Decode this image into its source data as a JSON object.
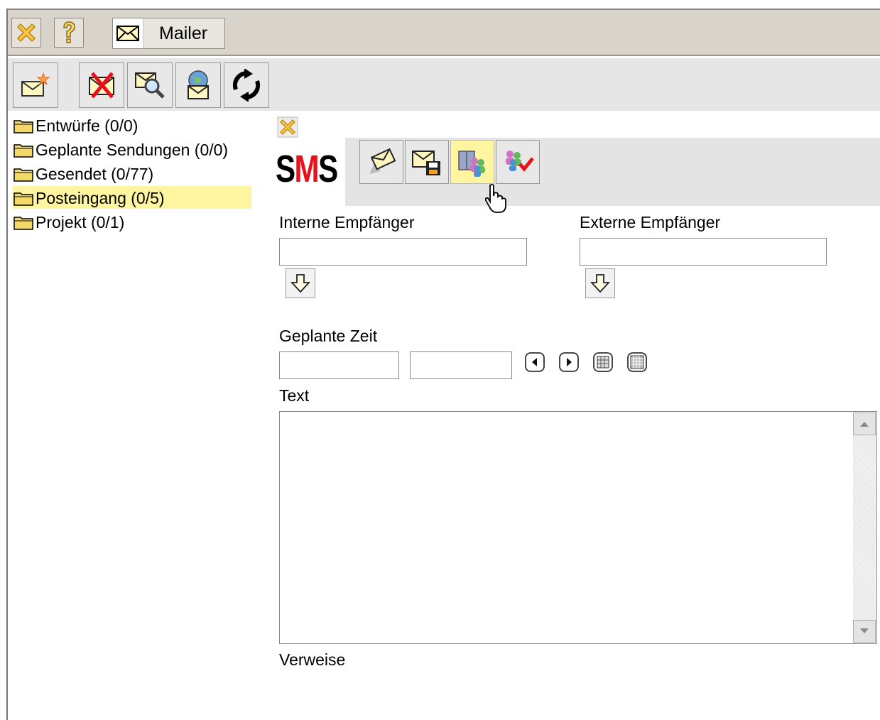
{
  "app": {
    "tab_label": "Mailer"
  },
  "folders": [
    {
      "label": "Entwürfe (0/0)"
    },
    {
      "label": "Geplante Sendungen (0/0)"
    },
    {
      "label": "Gesendet (0/77)"
    },
    {
      "label": "Posteingang (0/5)",
      "selected": true
    },
    {
      "label": "Projekt (0/1)"
    }
  ],
  "sms": {
    "logo_s1": "S",
    "logo_m": "M",
    "logo_s2": "S",
    "internal_label": "Interne Empfänger",
    "external_label": "Externe Empfänger",
    "internal_value": "",
    "external_value": "",
    "planned_label": "Geplante Zeit",
    "date_value": "",
    "time_value": "",
    "text_label": "Text",
    "text_value": "",
    "links_label": "Verweise"
  },
  "colors": {
    "highlight": "#fff5a0",
    "logo_accent": "#e8101a",
    "toolbar_bg": "#e4e4e4"
  }
}
